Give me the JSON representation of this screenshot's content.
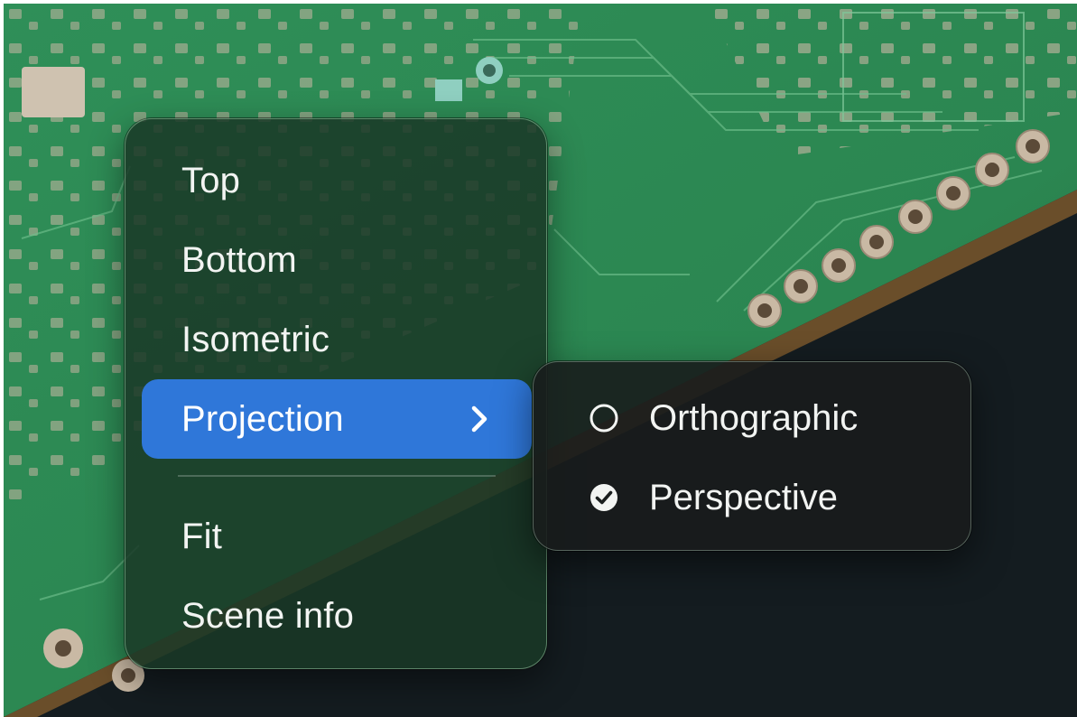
{
  "context_menu": {
    "items": [
      {
        "label": "Top"
      },
      {
        "label": "Bottom"
      },
      {
        "label": "Isometric"
      },
      {
        "label": "Projection",
        "has_submenu": true,
        "highlighted": true
      },
      {
        "label": "Fit"
      },
      {
        "label": "Scene info"
      }
    ]
  },
  "projection_submenu": {
    "items": [
      {
        "label": "Orthographic",
        "selected": false,
        "icon": "radio-empty-icon"
      },
      {
        "label": "Perspective",
        "selected": true,
        "icon": "radio-checked-icon"
      }
    ]
  },
  "colors": {
    "pcb_green": "#2e8c56",
    "highlight_blue": "#2f77d9",
    "background_dark": "#121a1d"
  }
}
